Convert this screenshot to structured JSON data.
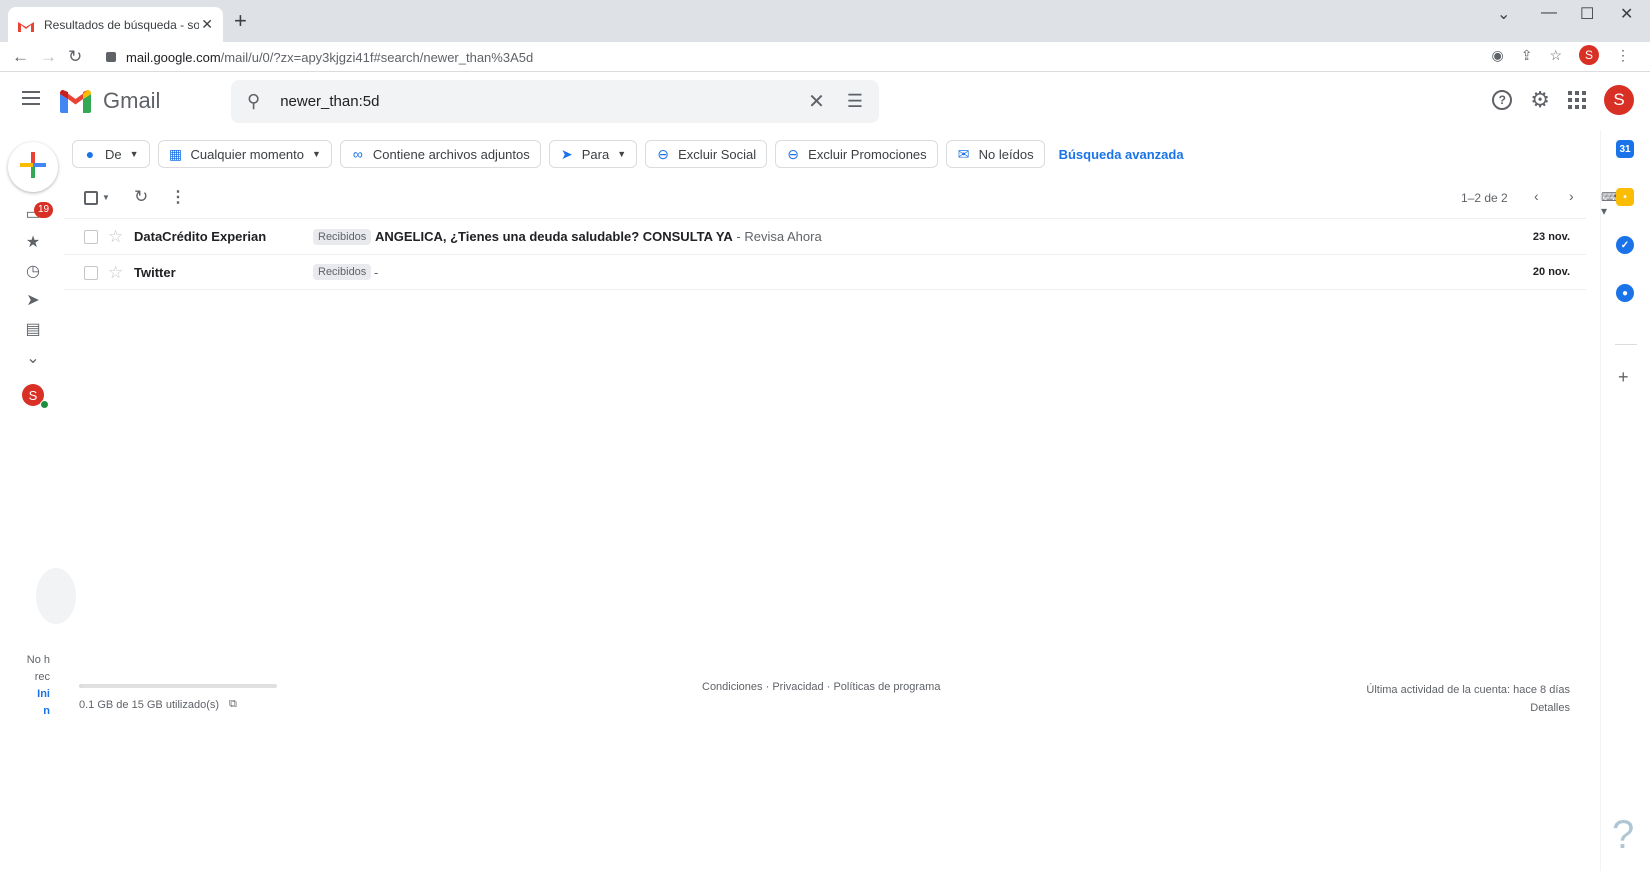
{
  "browser": {
    "tab_title": "Resultados de búsqueda - solve",
    "url_host": "mail.google.com",
    "url_path": "/mail/u/0/?zx=apy3kjgzi41f#search/newer_than%3A5d",
    "avatar_letter": "S"
  },
  "gmail": {
    "brand": "Gmail",
    "search_query": "newer_than:5d",
    "avatar_letter": "S"
  },
  "rail": {
    "inbox_badge": "19",
    "avatar_letter": "S",
    "hint_lines": [
      "No h",
      "rec",
      "Ini",
      "n"
    ]
  },
  "filters": {
    "chips": [
      {
        "label": "De",
        "icon": "person-icon",
        "dropdown": true
      },
      {
        "label": "Cualquier momento",
        "icon": "calendar-icon",
        "dropdown": true
      },
      {
        "label": "Contiene archivos adjuntos",
        "icon": "attachment-icon",
        "dropdown": false
      },
      {
        "label": "Para",
        "icon": "send-icon",
        "dropdown": true
      },
      {
        "label": "Excluir Social",
        "icon": "minus-circle-icon",
        "dropdown": false
      },
      {
        "label": "Excluir Promociones",
        "icon": "minus-circle-icon",
        "dropdown": false
      },
      {
        "label": "No leídos",
        "icon": "unread-mail-icon",
        "dropdown": false
      }
    ],
    "advanced_link": "Búsqueda avanzada"
  },
  "list": {
    "count": "1–2 de 2",
    "rows": [
      {
        "sender": "DataCrédito Experian",
        "label": "Recibidos",
        "subject": "ANGELICA, ¿Tienes una deuda saludable? CONSULTA YA",
        "snippet": " - Revisa Ahora",
        "date": "23 nov."
      },
      {
        "sender": "Twitter",
        "label": "Recibidos",
        "subject": "",
        "snippet": "-",
        "date": "20 nov."
      }
    ]
  },
  "footer": {
    "storage": "0.1 GB de 15 GB utilizado(s)",
    "storage_fraction": 0.0067,
    "links": "Condiciones · Privacidad · Políticas de programa",
    "activity": "Última actividad de la cuenta: hace 8 días",
    "details": "Detalles"
  },
  "colors": {
    "accent": "#1a73e8",
    "avatar": "#d93025",
    "calendar": "#1a73e8",
    "keep": "#fbbc04",
    "tasks": "#1a73e8",
    "contacts": "#1a73e8"
  }
}
